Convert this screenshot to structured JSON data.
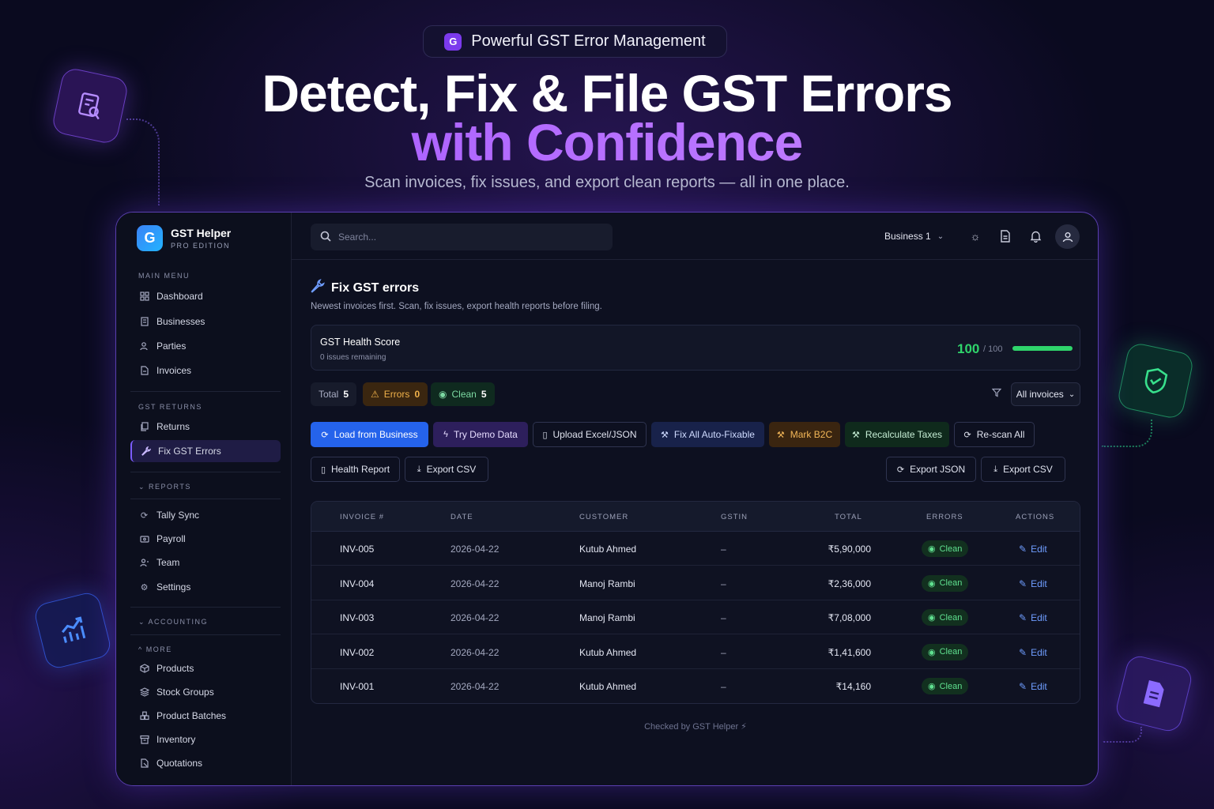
{
  "hero": {
    "pill": "Powerful GST Error Management",
    "headline_line1": "Detect, Fix & File GST Errors",
    "headline_line2": "with Confidence",
    "subtitle": "Scan invoices, fix issues, and export clean reports — all in one place."
  },
  "colors": {
    "accent": "#7c3aed",
    "primary": "#2563eb",
    "success": "#2fd46b",
    "warning": "#f0b14a"
  },
  "app": {
    "brand": {
      "name": "GST Helper",
      "edition": "PRO EDITION",
      "logo_glyph": "G"
    },
    "sidebar": {
      "main_menu_label": "MAIN MENU",
      "main_menu": [
        {
          "label": "Dashboard",
          "icon": "grid-icon"
        },
        {
          "label": "Businesses",
          "icon": "building-icon"
        },
        {
          "label": "Parties",
          "icon": "users-icon"
        },
        {
          "label": "Invoices",
          "icon": "file-icon"
        }
      ],
      "gst_returns_label": "GST RETURNS",
      "gst_returns": [
        {
          "label": "Returns",
          "icon": "copy-icon"
        },
        {
          "label": "Fix GST Errors",
          "icon": "wrench-icon",
          "active": true
        }
      ],
      "reports_label": "REPORTS",
      "reports": [
        {
          "label": "Tally Sync",
          "icon": "refresh-icon"
        },
        {
          "label": "Payroll",
          "icon": "wallet-icon"
        },
        {
          "label": "Team",
          "icon": "team-icon"
        },
        {
          "label": "Settings",
          "icon": "gear-icon"
        }
      ],
      "accounting_label": "ACCOUNTING",
      "more_label": "MORE",
      "more": [
        {
          "label": "Products",
          "icon": "box-icon"
        },
        {
          "label": "Stock Groups",
          "icon": "layers-icon"
        },
        {
          "label": "Product Batches",
          "icon": "boxes-icon"
        },
        {
          "label": "Inventory",
          "icon": "archive-icon"
        },
        {
          "label": "Quotations",
          "icon": "quote-icon"
        }
      ]
    },
    "topbar": {
      "search_placeholder": "Search...",
      "business": "Business 1"
    },
    "page": {
      "title": "Fix GST errors",
      "subtitle": "Newest invoices first. Scan, fix issues, export health reports before filing.",
      "health": {
        "title": "GST Health Score",
        "issues": "0 issues remaining",
        "score": "100",
        "max": "/ 100",
        "fraction": 1.0
      },
      "chips": {
        "total_label": "Total",
        "total": "5",
        "errors_label": "Errors",
        "errors": "0",
        "clean_label": "Clean",
        "clean": "5"
      },
      "filter": "All invoices",
      "buttons": {
        "load": "Load from Business",
        "demo": "Try Demo Data",
        "upload": "Upload Excel/JSON",
        "fix_all": "Fix All Auto-Fixable",
        "b2c": "Mark B2C",
        "recalc": "Recalculate Taxes",
        "rescan": "Re-scan All",
        "health_report": "Health Report",
        "export_csv_left": "Export CSV",
        "export_json": "Export JSON",
        "export_csv_right": "Export CSV"
      },
      "table": {
        "columns": [
          "INVOICE #",
          "DATE",
          "CUSTOMER",
          "GSTIN",
          "TOTAL",
          "ERRORS",
          "ACTIONS"
        ],
        "rows": [
          {
            "invoice": "INV-005",
            "date": "2026-04-22",
            "customer": "Kutub Ahmed",
            "gstin": "–",
            "total": "₹5,90,000",
            "errors": "Clean",
            "action": "Edit"
          },
          {
            "invoice": "INV-004",
            "date": "2026-04-22",
            "customer": "Manoj Rambi",
            "gstin": "–",
            "total": "₹2,36,000",
            "errors": "Clean",
            "action": "Edit"
          },
          {
            "invoice": "INV-003",
            "date": "2026-04-22",
            "customer": "Manoj Rambi",
            "gstin": "–",
            "total": "₹7,08,000",
            "errors": "Clean",
            "action": "Edit"
          },
          {
            "invoice": "INV-002",
            "date": "2026-04-22",
            "customer": "Kutub Ahmed",
            "gstin": "–",
            "total": "₹1,41,600",
            "errors": "Clean",
            "action": "Edit"
          },
          {
            "invoice": "INV-001",
            "date": "2026-04-22",
            "customer": "Kutub Ahmed",
            "gstin": "–",
            "total": "₹14,160",
            "errors": "Clean",
            "action": "Edit"
          }
        ]
      },
      "footer": "Checked by GST Helper ⚡"
    }
  }
}
